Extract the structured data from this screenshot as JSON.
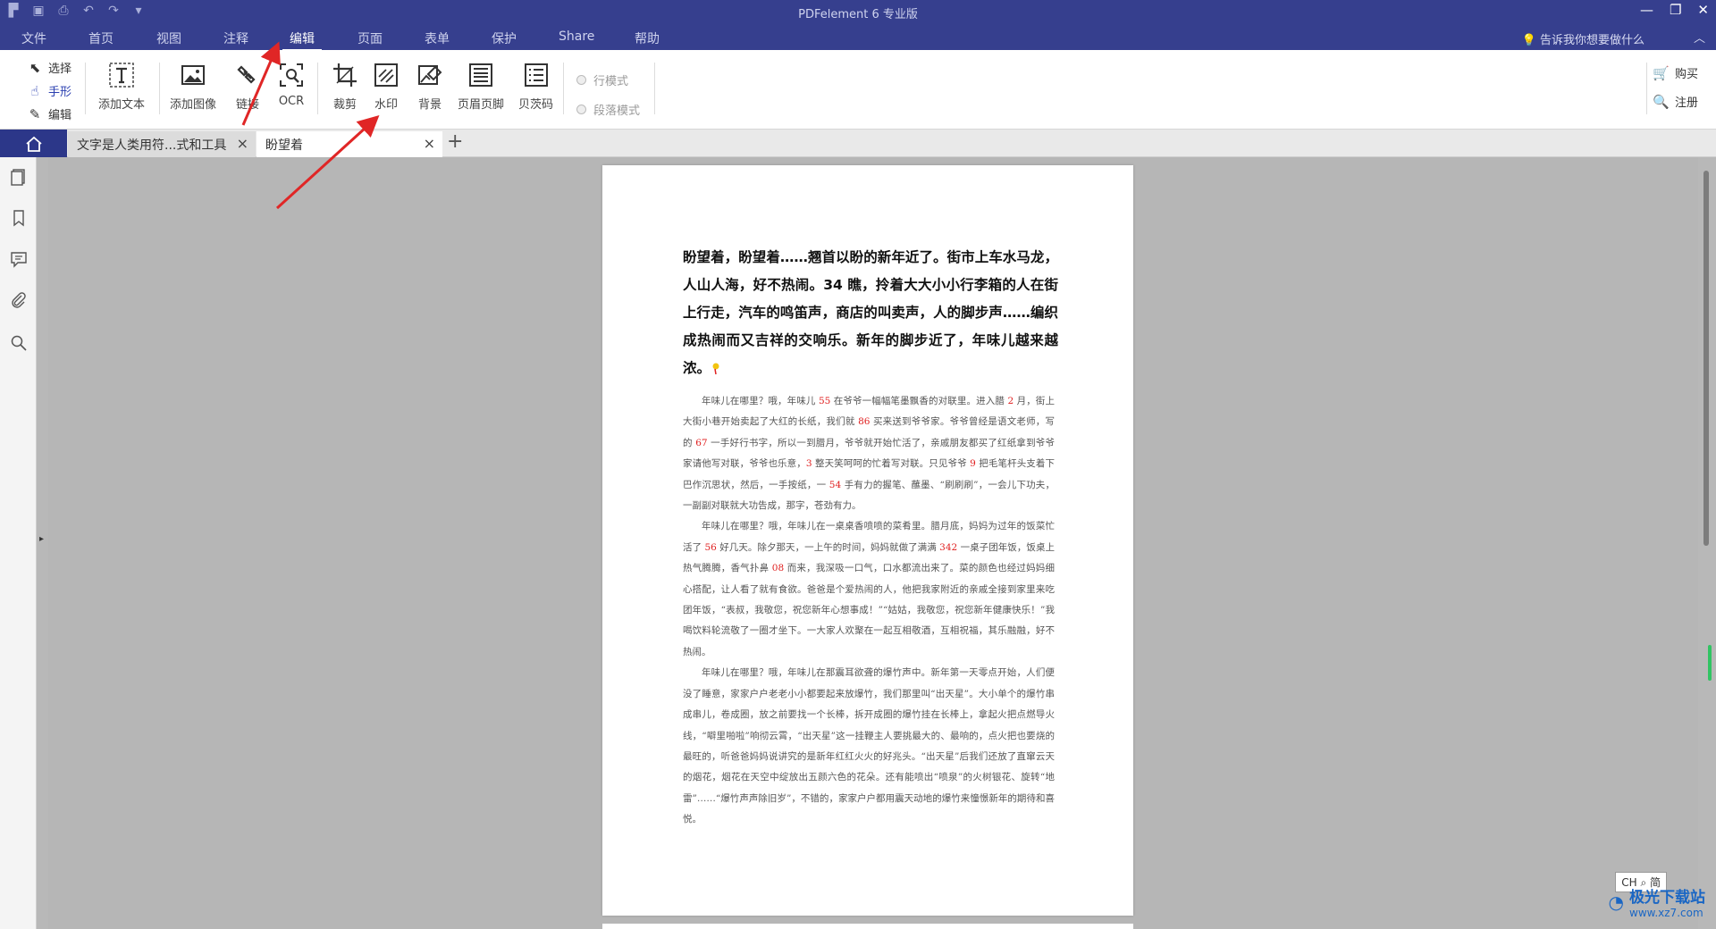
{
  "app": {
    "title": "PDFelement  6 专业版"
  },
  "quick_access": [
    "logo-icon",
    "save-icon",
    "print-icon",
    "undo-icon",
    "redo-icon",
    "customize-icon"
  ],
  "menu": {
    "tabs": [
      "文件",
      "首页",
      "视图",
      "注释",
      "编辑",
      "页面",
      "表单",
      "保护",
      "Share",
      "帮助"
    ],
    "active": "编辑",
    "hint": "告诉我你想要做什么"
  },
  "ribbon": {
    "modes": {
      "select": "选择",
      "hand": "手形",
      "edit": "编辑"
    },
    "buttons": {
      "add_text": "添加文本",
      "add_image": "添加图像",
      "link": "链接",
      "ocr": "OCR",
      "crop": "裁剪",
      "watermark": "水印",
      "background": "背景",
      "header_footer": "页眉页脚",
      "bates": "贝茨码"
    },
    "radios": {
      "line_mode": "行模式",
      "paragraph_mode": "段落模式"
    },
    "right": {
      "buy": "购买",
      "register": "注册"
    }
  },
  "tabs_bar": {
    "doc1": "文字是人类用符...式和工具",
    "doc2": "盼望着"
  },
  "document": {
    "heading": "盼望着，盼望着……翘首以盼的新年近了。街市上车水马龙，人山人海，好不热闹。34 瞧，拎着大大小小行李箱的人在街上行走，汽车的鸣笛声，商店的叫卖声，人的脚步声……编织成热闹而又吉祥的交响乐。新年的脚步近了，年味儿越来越浓。",
    "p1": {
      "a": "年味儿在哪里？哦，年味儿 ",
      "n1": "55",
      "b": " 在爷爷一幅幅笔墨飘香的对联里。进入腊 ",
      "n2": "2",
      "c": " 月，街上大街小巷开始卖起了大红的长纸，我们就 ",
      "n3": "86",
      "d": " 买来送到爷爷家。爷爷曾经是语文老师，写的 ",
      "n4": "67",
      "e": " 一手好行书字，所以一到腊月，爷爷就开始忙活了，亲戚朋友都买了红纸拿到爷爷家请他写对联，爷爷也乐意，",
      "n5": "3",
      "f": " 整天笑呵呵的忙着写对联。只见爷爷 ",
      "n6": "9",
      "g": " 把毛笔杆头支着下巴作沉思状，然后，一手按纸，一 ",
      "n7": "54",
      "h": " 手有力的握笔、蘸墨、“刷刷刷”，一会儿下功夫，一副副对联就大功告成，那字，苍劲有力。"
    },
    "p2": {
      "a": "年味儿在哪里？哦，年味儿在一桌桌香喷喷的菜肴里。腊月底，妈妈为过年的饭菜忙活了 ",
      "n1": "56",
      "b": " 好几天。除夕那天，一上午的时间，妈妈就做了满满 ",
      "n2": "342",
      "c": " 一桌子团年饭，饭桌上热气腾腾，香气扑鼻 ",
      "n3": "08",
      "d": " 而来，我深吸一口气，口水都流出来了。菜的颜色也经过妈妈细心搭配，让人看了就有食欲。爸爸是个爱热闹的人，他把我家附近的亲戚全接到家里来吃团年饭，“表叔，我敬您，祝您新年心想事成！”“姑姑，我敬您，祝您新年健康快乐！”我喝饮料轮流敬了一圈才坐下。一大家人欢聚在一起互相敬酒，互相祝福，其乐融融，好不热闹。"
    },
    "p3": "年味儿在哪里？哦，年味儿在那震耳欲聋的爆竹声中。新年第一天零点开始，人们便没了睡意，家家户户老老小小都要起来放爆竹，我们那里叫“出天星”。大小单个的爆竹串成串儿，卷成圈，放之前要找一个长棒，拆开成圈的爆竹挂在长棒上，拿起火把点燃导火线，“噼里啪啦”响彻云霄，“出天星”这一挂鞭主人要挑最大的、最响的，点火把也要烧的最旺的，听爸爸妈妈说讲究的是新年红红火火的好兆头。“出天星”后我们还放了直窜云天的烟花，烟花在天空中绽放出五颜六色的花朵。还有能喷出“喷泉”的火树银花、旋转“地雷”……“爆竹声声除旧岁”，不错的，家家户户都用震天动地的爆竹来憧憬新年的期待和喜悦。"
  },
  "status": {
    "ime": "CH ⌕ 简",
    "watermark_site": "极光下载站",
    "watermark_url": "www.xz7.com"
  },
  "colors": {
    "titlebar": "#363f8e",
    "highlight_number": "#e02020",
    "annotation_arrow": "#e02626"
  }
}
